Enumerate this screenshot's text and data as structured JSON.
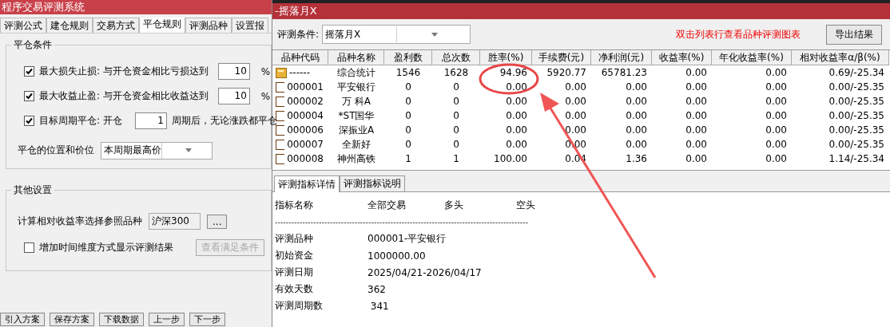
{
  "left_window": {
    "title": "程序交易评测系统",
    "tabs": [
      {
        "label": "评测公式",
        "selected": false
      },
      {
        "label": "建仓规则",
        "selected": false
      },
      {
        "label": "交易方式",
        "selected": false
      },
      {
        "label": "平仓规则",
        "selected": true
      },
      {
        "label": "评测品种",
        "selected": false
      },
      {
        "label": "设置报",
        "selected": false
      }
    ],
    "close_group": {
      "title": "平仓条件",
      "rows": [
        {
          "label": "最大损失止损: 与开仓资金相比亏损达到",
          "checked": true,
          "value": "10",
          "unit": "%"
        },
        {
          "label": "最大收益止盈: 与开仓资金相比收益达到",
          "checked": true,
          "value": "10",
          "unit": "%"
        },
        {
          "label": "目标周期平仓: 开仓",
          "checked": true,
          "value": "1",
          "unit": "周期后，无论涨跌都平仓"
        }
      ],
      "position_label": "平仓的位置和价位",
      "position_value": "本周期最高价"
    },
    "other_group": {
      "title": "其他设置",
      "reference_label": "计算相对收益率选择参照品种",
      "reference_value": "沪深300",
      "browse_button": "...",
      "time_dimension": {
        "label": "增加时间维度方式显示评测结果",
        "checked": false
      },
      "conditions_button": {
        "label": "查看满足条件",
        "disabled": true
      }
    },
    "bottom_buttons": [
      "引入方案",
      "保存方案",
      "下载数据",
      "上一步",
      "下一步"
    ]
  },
  "right_window": {
    "title": "-摇落月X",
    "condition_label": "评测条件:",
    "condition_value": "摇落月X",
    "hint": "双击列表行查看品种评测图表",
    "export_button": "导出结果",
    "table": {
      "columns": [
        "品种代码",
        "品种名称",
        "盈利数",
        "总次数",
        "胜率(%)",
        "手续费(元)",
        "净利润(元)",
        "收益率(%)",
        "年化收益率(%)",
        "相对收益率α/β(%)"
      ],
      "rows": [
        {
          "kind": "summary",
          "cells": [
            "------",
            "综合统计",
            "1546",
            "1628",
            "94.96",
            "5920.77",
            "65781.23",
            "0.00",
            "0.00",
            "0.69/-25.34"
          ]
        },
        {
          "kind": "item",
          "cells": [
            "000001",
            "平安银行",
            "0",
            "0",
            "0.00",
            "0.00",
            "0.00",
            "0.00",
            "0.00",
            "0.00/-25.35"
          ]
        },
        {
          "kind": "item",
          "cells": [
            "000002",
            "万 科A",
            "0",
            "0",
            "0.00",
            "0.00",
            "0.00",
            "0.00",
            "0.00",
            "0.00/-25.35"
          ]
        },
        {
          "kind": "item",
          "cells": [
            "000004",
            "*ST国华",
            "0",
            "0",
            "0.00",
            "0.00",
            "0.00",
            "0.00",
            "0.00",
            "0.00/-25.35"
          ]
        },
        {
          "kind": "item",
          "cells": [
            "000006",
            "深振业A",
            "0",
            "0",
            "0.00",
            "0.00",
            "0.00",
            "0.00",
            "0.00",
            "0.00/-25.35"
          ]
        },
        {
          "kind": "item",
          "cells": [
            "000007",
            "全新好",
            "0",
            "0",
            "0.00",
            "0.00",
            "0.00",
            "0.00",
            "0.00",
            "0.00/-25.35"
          ]
        },
        {
          "kind": "item",
          "cells": [
            "000008",
            "神州高铁",
            "1",
            "1",
            "100.00",
            "0.04",
            "1.36",
            "0.00",
            "0.00",
            "1.14/-25.34"
          ]
        }
      ]
    },
    "detail_tabs": [
      {
        "label": "评测指标详情",
        "selected": true
      },
      {
        "label": "评测指标说明",
        "selected": false
      }
    ],
    "detail": {
      "header": [
        "指标名称",
        "全部交易",
        "多头",
        "空头"
      ],
      "separator": "--------------------------------------------------------------------------------------------",
      "rows": [
        {
          "label": "评测品种",
          "value": "000001-平安银行"
        },
        {
          "label": "初始资金",
          "value": "1000000.00"
        },
        {
          "label": "评测日期",
          "value": "2025/04/21-2026/04/17"
        },
        {
          "label": "有效天数",
          "value": "362"
        },
        {
          "label": "评测周期数",
          "value": " 341"
        }
      ]
    }
  }
}
